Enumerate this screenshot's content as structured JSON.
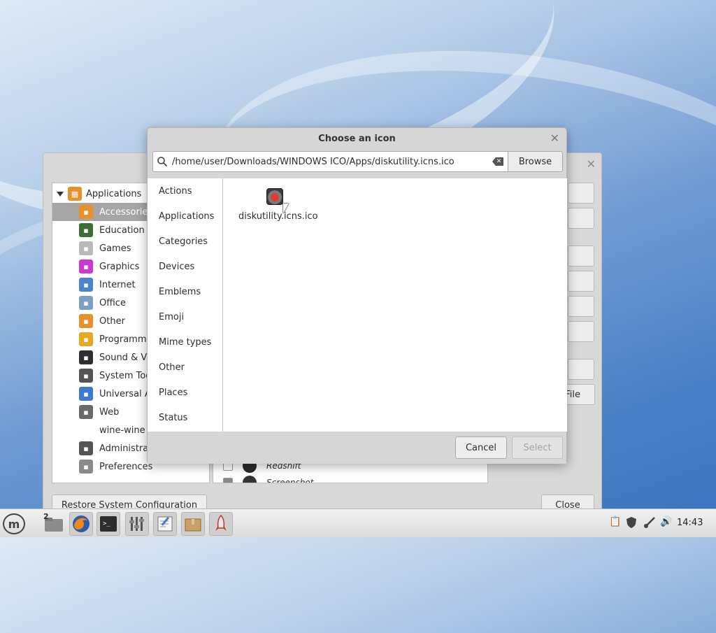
{
  "desktop": {
    "wallpaper": "blue-waves"
  },
  "menu_editor": {
    "tree_root": "Applications",
    "categories": [
      {
        "label": "Accessories",
        "color": "#e8902a",
        "selected": true
      },
      {
        "label": "Education",
        "color": "#3d6e33"
      },
      {
        "label": "Games",
        "color": "#b9b9b9"
      },
      {
        "label": "Graphics",
        "color": "#c83ad1"
      },
      {
        "label": "Internet",
        "color": "#4a83cf"
      },
      {
        "label": "Office",
        "color": "#7aa0c8"
      },
      {
        "label": "Other",
        "color": "#e8902a"
      },
      {
        "label": "Programmi",
        "color": "#e6a91f"
      },
      {
        "label": "Sound & Vi",
        "color": "#2f2f2f"
      },
      {
        "label": "System Too",
        "color": "#555555"
      },
      {
        "label": "Universal A",
        "color": "#3a7ad0"
      },
      {
        "label": "Web",
        "color": "#6a6a6a"
      },
      {
        "label": "wine-wine",
        "color": ""
      },
      {
        "label": "Administrat",
        "color": "#555555"
      },
      {
        "label": "Preferences",
        "color": "#8a8a8a"
      }
    ],
    "items_partial": [
      {
        "label": "Redshift",
        "checked": false
      },
      {
        "label": "Screenshot",
        "checked": true
      }
    ],
    "file_button_fragment": "File",
    "restore_button": "Restore System Configuration",
    "close_button": "Close"
  },
  "dialog": {
    "title": "Choose an icon",
    "path_value": "/home/user/Downloads/WINDOWS ICO/Apps/diskutility.icns.ico",
    "browse_label": "Browse",
    "contexts": [
      "Actions",
      "Applications",
      "Categories",
      "Devices",
      "Emblems",
      "Emoji",
      "Mime types",
      "Other",
      "Places",
      "Status"
    ],
    "files": [
      {
        "label": "diskutility.icns.ico",
        "icon": "disk-utility-icon"
      }
    ],
    "cancel_label": "Cancel",
    "select_label": "Select",
    "select_enabled": false
  },
  "taskbar": {
    "menu_icon": "linux-mint-icon",
    "workspace_badge": "2",
    "launchers": [
      "file-manager-icon",
      "firefox-icon",
      "terminal-icon",
      "mixer-icon",
      "text-editor-icon",
      "archive-icon",
      "rocket-icon"
    ],
    "tray": [
      "clipboard-icon",
      "shield-icon",
      "network-icon",
      "volume-icon"
    ],
    "clock": "14:43"
  }
}
